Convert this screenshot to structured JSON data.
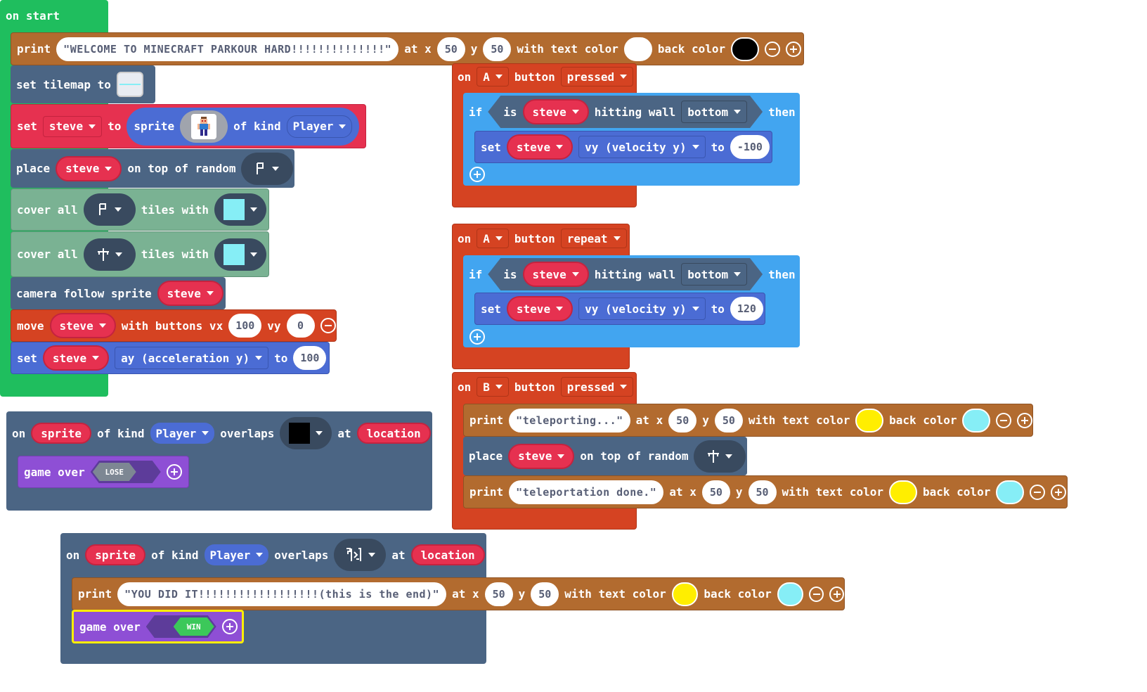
{
  "colors": {
    "white": "#ffffff",
    "black": "#000000",
    "yellow": "#ffee00",
    "cyan": "#86eef6",
    "loops_green": "#1fbe5e",
    "controller_red": "#d54322",
    "logic_blue": "#42a5f0",
    "sprite_blue": "#4b6cd4",
    "scene_dark": "#4b6584",
    "scene_green": "#7ab293",
    "game_purple": "#8e4fd5",
    "text_brown": "#b26b2f",
    "sprite_red": "#e63150"
  },
  "on_start": {
    "hat": "on start",
    "print1": {
      "kw": "print",
      "text": "\"WELCOME TO MINECRAFT PARKOUR HARD!!!!!!!!!!!!!!\"",
      "at_x": "at x",
      "x": "50",
      "y_lbl": "y",
      "y": "50",
      "tc": "with text color",
      "bc": "back color"
    },
    "set_tilemap": {
      "kw": "set tilemap to"
    },
    "set_steve": {
      "set": "set",
      "var": "steve",
      "to": "to",
      "sprite": "sprite",
      "kind_lbl": "of kind",
      "kind": "Player"
    },
    "place": {
      "kw": "place",
      "var": "steve",
      "rest": "on top of random"
    },
    "cover1": {
      "kw": "cover all",
      "mid": "tiles with"
    },
    "cover2": {
      "kw": "cover all",
      "mid": "tiles with"
    },
    "camera": {
      "kw": "camera follow sprite",
      "var": "steve"
    },
    "move": {
      "kw": "move",
      "var": "steve",
      "mid": "with buttons vx",
      "vx": "100",
      "vy_lbl": "vy",
      "vy": "0"
    },
    "set_ay": {
      "kw": "set",
      "var": "steve",
      "prop": "ay (acceleration y)",
      "to": "to",
      "val": "100"
    }
  },
  "a_pressed": {
    "on": "on",
    "btn": "A",
    "button": "button",
    "evt": "pressed",
    "if": "if",
    "is": "is",
    "var": "steve",
    "hw": "hitting wall",
    "side": "bottom",
    "then": "then",
    "set": "set",
    "var2": "steve",
    "prop": "vy (velocity y)",
    "to": "to",
    "val": "-100"
  },
  "a_repeat": {
    "on": "on",
    "btn": "A",
    "button": "button",
    "evt": "repeat",
    "if": "if",
    "is": "is",
    "var": "steve",
    "hw": "hitting wall",
    "side": "bottom",
    "then": "then",
    "set": "set",
    "var2": "steve",
    "prop": "vy (velocity y)",
    "to": "to",
    "val": "120"
  },
  "b_pressed": {
    "on": "on",
    "btn": "B",
    "button": "button",
    "evt": "pressed",
    "p1": {
      "kw": "print",
      "text": "\"teleporting...\"",
      "at_x": "at x",
      "x": "50",
      "y_lbl": "y",
      "y": "50",
      "tc": "with text color",
      "bc": "back color"
    },
    "place": {
      "kw": "place",
      "var": "steve",
      "rest": "on top of random"
    },
    "p2": {
      "kw": "print",
      "text": "\"teleportation done.\"",
      "at_x": "at x",
      "x": "50",
      "y_lbl": "y",
      "y": "50",
      "tc": "with text color",
      "bc": "back color"
    }
  },
  "overlap_lose": {
    "on": "on",
    "sprite": "sprite",
    "kind_lbl": "of kind",
    "kind": "Player",
    "overlaps": "overlaps",
    "at": "at",
    "loc": "location",
    "game_over": "game over",
    "result": "LOSE"
  },
  "overlap_win": {
    "on": "on",
    "sprite": "sprite",
    "kind_lbl": "of kind",
    "kind": "Player",
    "overlaps": "overlaps",
    "at": "at",
    "loc": "location",
    "print": {
      "kw": "print",
      "text": "\"YOU DID IT!!!!!!!!!!!!!!!!!!(this is the end)\"",
      "at_x": "at x",
      "x": "50",
      "y_lbl": "y",
      "y": "50",
      "tc": "with text color",
      "bc": "back color"
    },
    "game_over": "game over",
    "result": "WIN"
  }
}
